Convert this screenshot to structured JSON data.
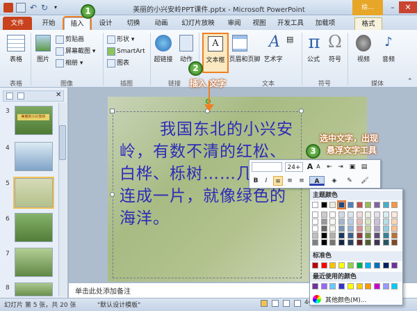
{
  "window": {
    "title": "美丽的小兴安岭PPT课件.pptx - Microsoft PowerPoint",
    "context_label": "绘..."
  },
  "tabs": [
    "文件",
    "开始",
    "插入",
    "设计",
    "切换",
    "动画",
    "幻灯片放映",
    "审阅",
    "视图",
    "开发工具",
    "加载项",
    "格式"
  ],
  "ribbon": {
    "table": {
      "label": "表格",
      "group": "表格"
    },
    "image_group": {
      "picture": "图片",
      "clipart": "剪贴画",
      "screenshot": "屏幕截图",
      "album": "相册",
      "group": "图像"
    },
    "illustration": {
      "shapes": "形状",
      "smartart": "SmartArt",
      "chart": "图表",
      "group": "插图"
    },
    "links": {
      "hyperlink": "超链接",
      "action": "动作",
      "group": "链接"
    },
    "text": {
      "textbox": "文本框",
      "header_footer": "页眉和页脚",
      "wordart": "艺术字",
      "group": "文本"
    },
    "symbols": {
      "equation": "公式",
      "symbol": "符号",
      "group": "符号"
    },
    "media": {
      "video": "视频",
      "audio": "音频",
      "group": "媒体"
    }
  },
  "annotations": {
    "step1": "1",
    "step2": "2",
    "step3": "3",
    "insert_text": "插入 文字",
    "select_text_line1": "选中文字，出现",
    "select_text_line2": "悬浮文字工具"
  },
  "slides": {
    "numbers": [
      "3",
      "4",
      "5",
      "6",
      "7",
      "8",
      "9"
    ],
    "selected": "5",
    "thumb3_caption": "美丽的小兴安岭"
  },
  "slide_text": "我国东北的小兴安岭，有数不清的红松、白桦、栎树……几百里连成一片，就像绿色的海洋。",
  "notes_placeholder": "单击此处添加备注",
  "status": {
    "slide_info": "幻灯片 第 5 张，共 20 张",
    "theme": "\"默认设计模板\"",
    "zoom_pct": "46%"
  },
  "mini_toolbar": {
    "font_size": "24+",
    "btn_grow": "A",
    "btn_shrink": "A",
    "bold": "B",
    "italic": "I",
    "font_color": "A"
  },
  "color_menu": {
    "theme_header": "主题颜色",
    "standard_header": "标准色",
    "recent_header": "最近使用的颜色",
    "more": "其他颜色(M)...",
    "theme_top": [
      "#ffffff",
      "#000000",
      "#eeece1",
      "#1f497d",
      "#4f81bd",
      "#c0504d",
      "#9bbb59",
      "#8064a2",
      "#4bacc6",
      "#f79646"
    ],
    "standard": [
      "#c00000",
      "#ff0000",
      "#ffc000",
      "#ffff00",
      "#92d050",
      "#00b050",
      "#00b0f0",
      "#0070c0",
      "#002060",
      "#7030a0"
    ],
    "recent": [
      "#7030a0",
      "#9966ff",
      "#66ccff",
      "#3333cc",
      "#ffff00",
      "#ffcc00",
      "#ff9900",
      "#cc00cc",
      "#9999ff",
      "#00ccff"
    ]
  }
}
